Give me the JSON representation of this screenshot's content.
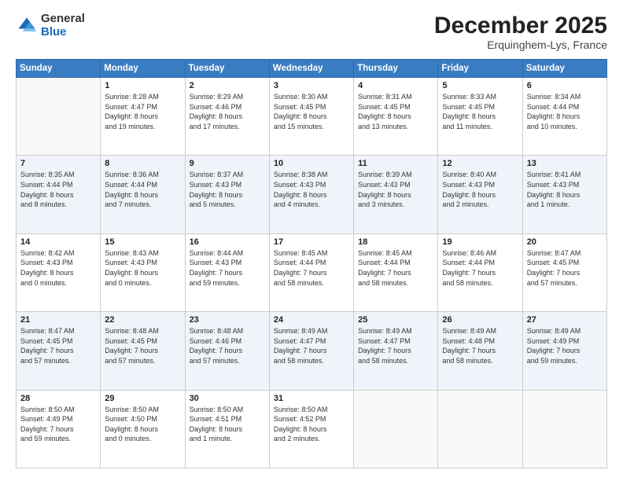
{
  "logo": {
    "general": "General",
    "blue": "Blue"
  },
  "header": {
    "month": "December 2025",
    "location": "Erquinghem-Lys, France"
  },
  "days_of_week": [
    "Sunday",
    "Monday",
    "Tuesday",
    "Wednesday",
    "Thursday",
    "Friday",
    "Saturday"
  ],
  "weeks": [
    [
      {
        "day": "",
        "info": ""
      },
      {
        "day": "1",
        "info": "Sunrise: 8:28 AM\nSunset: 4:47 PM\nDaylight: 8 hours\nand 19 minutes."
      },
      {
        "day": "2",
        "info": "Sunrise: 8:29 AM\nSunset: 4:46 PM\nDaylight: 8 hours\nand 17 minutes."
      },
      {
        "day": "3",
        "info": "Sunrise: 8:30 AM\nSunset: 4:45 PM\nDaylight: 8 hours\nand 15 minutes."
      },
      {
        "day": "4",
        "info": "Sunrise: 8:31 AM\nSunset: 4:45 PM\nDaylight: 8 hours\nand 13 minutes."
      },
      {
        "day": "5",
        "info": "Sunrise: 8:33 AM\nSunset: 4:45 PM\nDaylight: 8 hours\nand 11 minutes."
      },
      {
        "day": "6",
        "info": "Sunrise: 8:34 AM\nSunset: 4:44 PM\nDaylight: 8 hours\nand 10 minutes."
      }
    ],
    [
      {
        "day": "7",
        "info": "Sunrise: 8:35 AM\nSunset: 4:44 PM\nDaylight: 8 hours\nand 8 minutes."
      },
      {
        "day": "8",
        "info": "Sunrise: 8:36 AM\nSunset: 4:44 PM\nDaylight: 8 hours\nand 7 minutes."
      },
      {
        "day": "9",
        "info": "Sunrise: 8:37 AM\nSunset: 4:43 PM\nDaylight: 8 hours\nand 5 minutes."
      },
      {
        "day": "10",
        "info": "Sunrise: 8:38 AM\nSunset: 4:43 PM\nDaylight: 8 hours\nand 4 minutes."
      },
      {
        "day": "11",
        "info": "Sunrise: 8:39 AM\nSunset: 4:43 PM\nDaylight: 8 hours\nand 3 minutes."
      },
      {
        "day": "12",
        "info": "Sunrise: 8:40 AM\nSunset: 4:43 PM\nDaylight: 8 hours\nand 2 minutes."
      },
      {
        "day": "13",
        "info": "Sunrise: 8:41 AM\nSunset: 4:43 PM\nDaylight: 8 hours\nand 1 minute."
      }
    ],
    [
      {
        "day": "14",
        "info": "Sunrise: 8:42 AM\nSunset: 4:43 PM\nDaylight: 8 hours\nand 0 minutes."
      },
      {
        "day": "15",
        "info": "Sunrise: 8:43 AM\nSunset: 4:43 PM\nDaylight: 8 hours\nand 0 minutes."
      },
      {
        "day": "16",
        "info": "Sunrise: 8:44 AM\nSunset: 4:43 PM\nDaylight: 7 hours\nand 59 minutes."
      },
      {
        "day": "17",
        "info": "Sunrise: 8:45 AM\nSunset: 4:44 PM\nDaylight: 7 hours\nand 58 minutes."
      },
      {
        "day": "18",
        "info": "Sunrise: 8:45 AM\nSunset: 4:44 PM\nDaylight: 7 hours\nand 58 minutes."
      },
      {
        "day": "19",
        "info": "Sunrise: 8:46 AM\nSunset: 4:44 PM\nDaylight: 7 hours\nand 58 minutes."
      },
      {
        "day": "20",
        "info": "Sunrise: 8:47 AM\nSunset: 4:45 PM\nDaylight: 7 hours\nand 57 minutes."
      }
    ],
    [
      {
        "day": "21",
        "info": "Sunrise: 8:47 AM\nSunset: 4:45 PM\nDaylight: 7 hours\nand 57 minutes."
      },
      {
        "day": "22",
        "info": "Sunrise: 8:48 AM\nSunset: 4:45 PM\nDaylight: 7 hours\nand 57 minutes."
      },
      {
        "day": "23",
        "info": "Sunrise: 8:48 AM\nSunset: 4:46 PM\nDaylight: 7 hours\nand 57 minutes."
      },
      {
        "day": "24",
        "info": "Sunrise: 8:49 AM\nSunset: 4:47 PM\nDaylight: 7 hours\nand 58 minutes."
      },
      {
        "day": "25",
        "info": "Sunrise: 8:49 AM\nSunset: 4:47 PM\nDaylight: 7 hours\nand 58 minutes."
      },
      {
        "day": "26",
        "info": "Sunrise: 8:49 AM\nSunset: 4:48 PM\nDaylight: 7 hours\nand 58 minutes."
      },
      {
        "day": "27",
        "info": "Sunrise: 8:49 AM\nSunset: 4:49 PM\nDaylight: 7 hours\nand 59 minutes."
      }
    ],
    [
      {
        "day": "28",
        "info": "Sunrise: 8:50 AM\nSunset: 4:49 PM\nDaylight: 7 hours\nand 59 minutes."
      },
      {
        "day": "29",
        "info": "Sunrise: 8:50 AM\nSunset: 4:50 PM\nDaylight: 8 hours\nand 0 minutes."
      },
      {
        "day": "30",
        "info": "Sunrise: 8:50 AM\nSunset: 4:51 PM\nDaylight: 8 hours\nand 1 minute."
      },
      {
        "day": "31",
        "info": "Sunrise: 8:50 AM\nSunset: 4:52 PM\nDaylight: 8 hours\nand 2 minutes."
      },
      {
        "day": "",
        "info": ""
      },
      {
        "day": "",
        "info": ""
      },
      {
        "day": "",
        "info": ""
      }
    ]
  ]
}
